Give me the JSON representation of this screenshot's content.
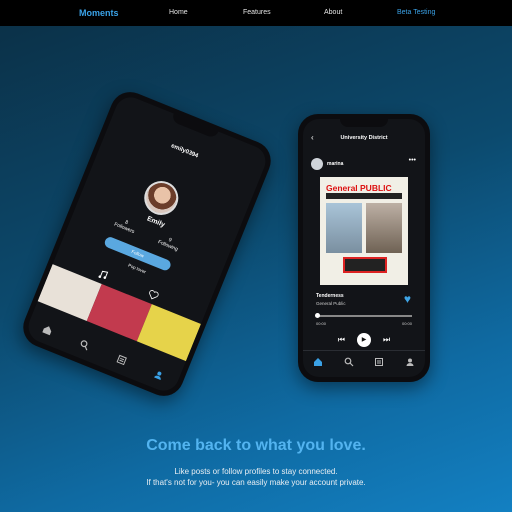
{
  "nav": {
    "brand": "Moments",
    "links": [
      "Home",
      "Features",
      "About",
      "Beta Testing"
    ]
  },
  "profile_phone": {
    "username": "emily0394",
    "display_name": "Emily",
    "followers_count": "8",
    "followers_label": "Followers",
    "following_count": "9",
    "following_label": "Following",
    "follow_button": "Follow",
    "bio": "Pop lover"
  },
  "music_phone": {
    "header": "University District",
    "post_user": "marina",
    "album_title": "General PUBLIC",
    "song_title": "Tenderness",
    "artist": "General Public",
    "time_start": "00:00",
    "time_end": "00:00"
  },
  "hero": {
    "headline": "Come back to what you love.",
    "sub_line_1": "Like posts or follow profiles to stay connected.",
    "sub_line_2": "If that's not for you- you can easily make your account private."
  },
  "colors": {
    "accent": "#3aa1e6",
    "headline": "#53b4f0"
  }
}
